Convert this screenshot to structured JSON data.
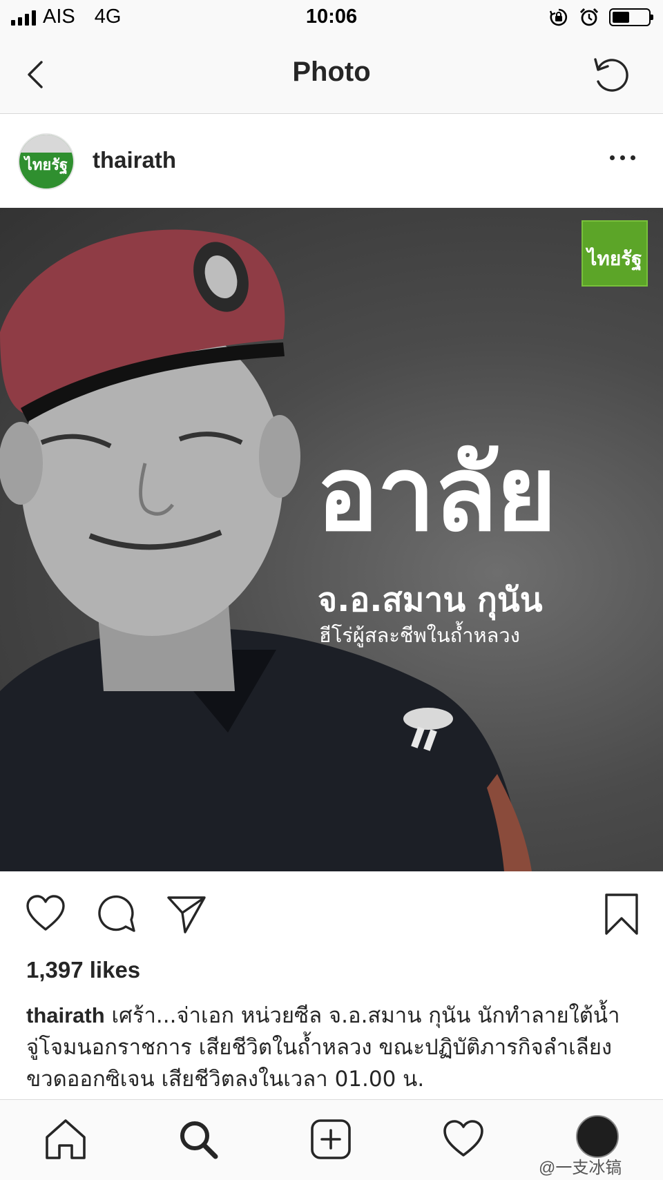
{
  "status_bar": {
    "carrier": "AIS",
    "network": "4G",
    "time": "10:06"
  },
  "nav": {
    "title": "Photo"
  },
  "post": {
    "username": "thairath",
    "avatar_text": "ไทยรัฐ",
    "photo": {
      "brand_badge": "ไทยรัฐ",
      "headline": "อาลัย",
      "subline": "จ.อ.สมาน กุนัน",
      "tagline": "ฮีโร่ผู้สละชีพในถ้ำหลวง"
    },
    "likes": "1,397 likes",
    "caption_user": "thairath",
    "caption_text": "เศร้า...จ่าเอก หน่วยซีล จ.อ.สมาน กุนัน นักทำลายใต้น้ำจู่โจมนอกราชการ เสียชีวิตในถ้ำหลวง ขณะปฏิบัติภารกิจลำเลียงขวดออกซิเจน เสียชีวิตลงในเวลา 01.00 น."
  },
  "tab_bar": {
    "items": [
      "home",
      "search",
      "new-post",
      "activity",
      "profile"
    ]
  },
  "watermark": "@一支冰镐",
  "colors": {
    "brand_green": "#5ca528",
    "text": "#262626"
  }
}
